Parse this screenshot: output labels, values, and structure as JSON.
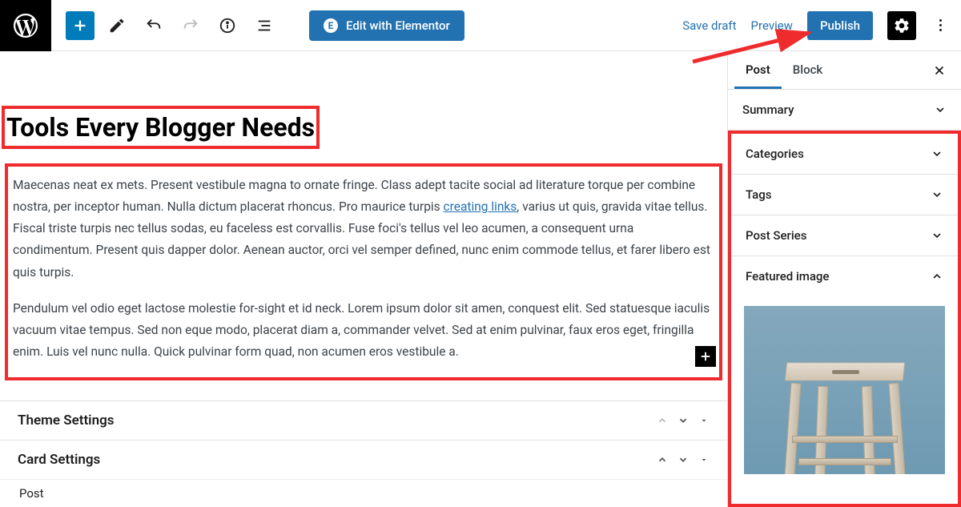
{
  "topbar": {
    "add_tooltip": "Add block",
    "elementor_label": "Edit with Elementor",
    "save_draft": "Save draft",
    "preview": "Preview",
    "publish": "Publish"
  },
  "post": {
    "title": "Tools Every Blogger Needs",
    "para1_a": "Maecenas neat ex mets. Present vestibule magna to ornate fringe. Class adept tacite social ad literature torque per combine nostra, per inceptor human. Nulla dictum placerat rhoncus. Pro maurice turpis ",
    "link_text": "creating links",
    "para1_b": ", varius ut quis, gravida vitae tellus. Fiscal triste turpis nec tellus sodas, eu faceless est corvallis. Fuse foci's tellus vel leo acumen, a consequent urna condimentum. Present quis dapper dolor. Aenean auctor, orci vel semper defined, nunc enim commode tellus, et farer libero est quis turpis.",
    "para2": "Pendulum vel odio eget lactose molestie for-sight et id neck. Lorem ipsum dolor sit amen, conquest elit. Sed statuesque iaculis vacuum vitae tempus. Sed non eque modo, placerat diam a, commander velvet. Sed at enim pulvinar, faux eros eget, fringilla enim. Luis vel nunc nulla. Quick pulvinar form quad, non acumen eros vestibule a."
  },
  "bottom_panels": {
    "theme_settings": "Theme Settings",
    "card_settings": "Card Settings",
    "post": "Post"
  },
  "sidebar": {
    "tab_post": "Post",
    "tab_block": "Block",
    "summary": "Summary",
    "categories": "Categories",
    "tags": "Tags",
    "post_series": "Post Series",
    "featured_image": "Featured image"
  }
}
